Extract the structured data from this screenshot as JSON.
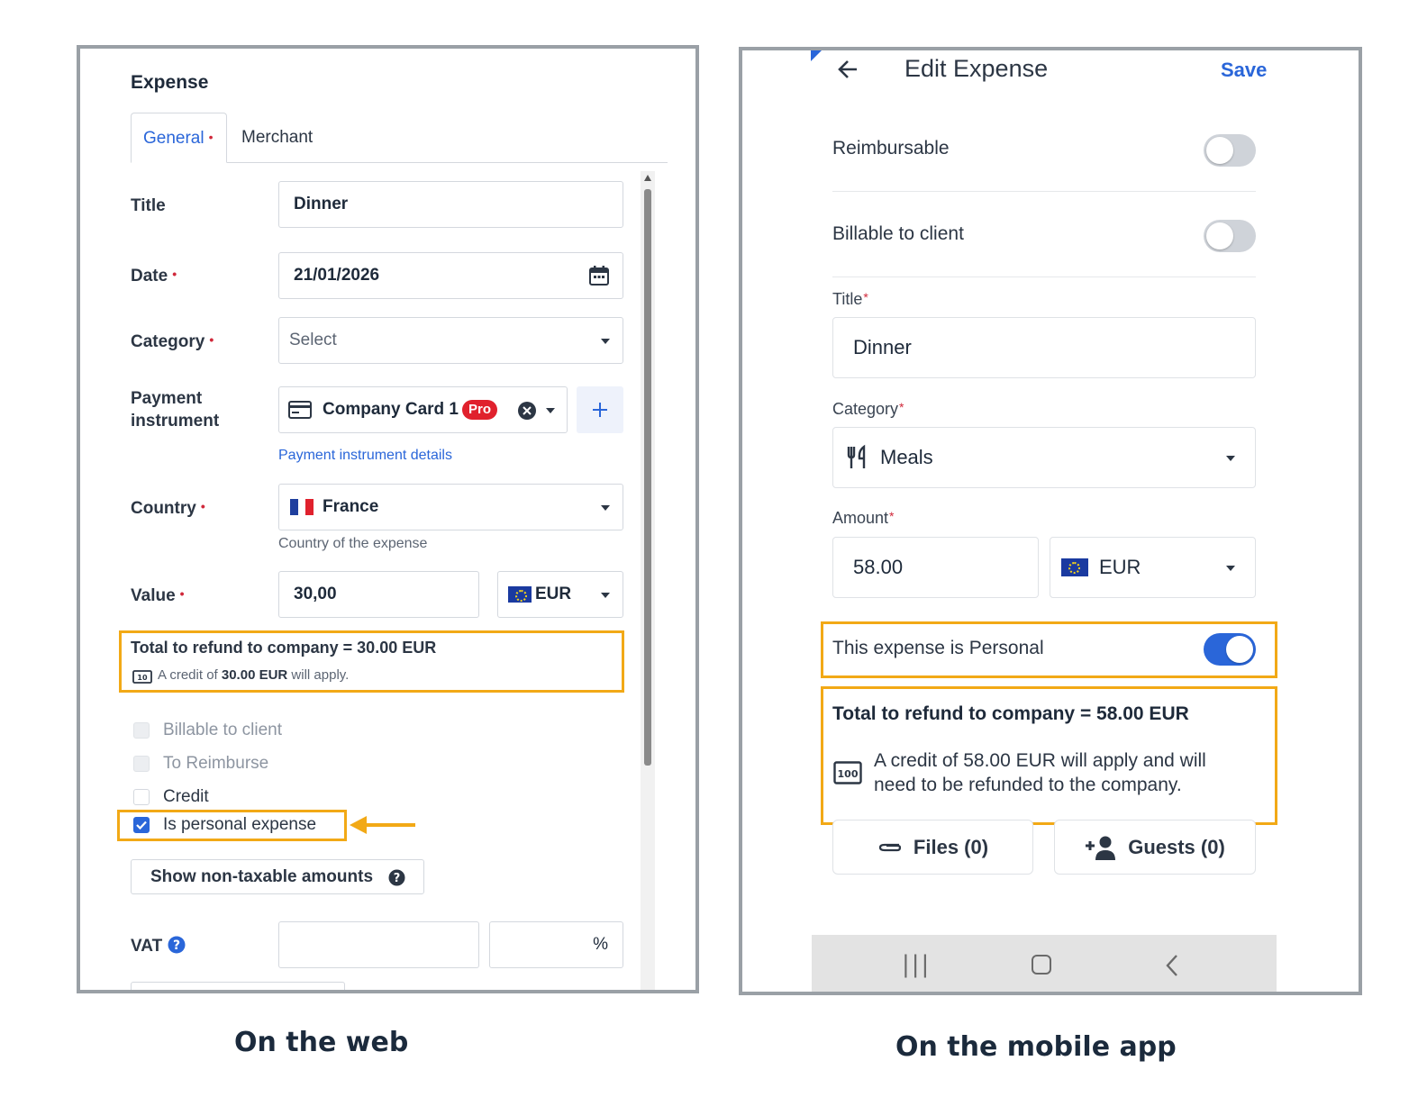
{
  "web": {
    "heading": "Expense",
    "tabs": [
      {
        "label": "General",
        "required": "•"
      },
      {
        "label": "Merchant"
      }
    ],
    "fields": {
      "title": {
        "label": "Title",
        "value": "Dinner"
      },
      "date": {
        "label": "Date",
        "required": "•",
        "value": "21/01/2026"
      },
      "category": {
        "label": "Category",
        "required": "•",
        "placeholder": "Select"
      },
      "payment": {
        "label_line1": "Payment",
        "label_line2": "instrument",
        "value": "Company Card 1",
        "badge": "Pro",
        "details_link": "Payment instrument details"
      },
      "country": {
        "label": "Country",
        "required": "•",
        "value": "France",
        "helper": "Country of the expense"
      },
      "value": {
        "label": "Value",
        "required": "•",
        "amount": "30,00",
        "currency": "EUR"
      },
      "vat": {
        "label": "VAT",
        "percent_symbol": "%"
      }
    },
    "refund": {
      "total_text": "Total to refund to company = 30.00 EUR",
      "credit_prefix": "A credit of ",
      "credit_amount": "30.00 EUR",
      "credit_suffix": " will apply."
    },
    "checkboxes": [
      {
        "label": "Billable to client",
        "state": "disabled"
      },
      {
        "label": "To Reimburse",
        "state": "disabled"
      },
      {
        "label": "Credit",
        "state": "unchecked"
      },
      {
        "label": "Is personal expense",
        "state": "checked"
      }
    ],
    "non_taxable_button": "Show non-taxable amounts",
    "flag_colors": {
      "blue": "#1f3f9e",
      "white": "#ffffff",
      "red": "#e0212d"
    },
    "highlight_color": "#f2a916"
  },
  "mobile": {
    "header": {
      "title": "Edit Expense",
      "save": "Save"
    },
    "toggles": {
      "reimbursable": {
        "label": "Reimbursable",
        "on": false
      },
      "billable": {
        "label": "Billable to client",
        "on": false
      },
      "personal": {
        "label": "This expense is Personal",
        "on": true
      }
    },
    "fields": {
      "title": {
        "label": "Title",
        "required": "*",
        "value": "Dinner"
      },
      "category": {
        "label": "Category",
        "required": "*",
        "value": "Meals"
      },
      "amount": {
        "label": "Amount",
        "required": "*",
        "value": "58.00",
        "currency": "EUR"
      }
    },
    "refund": {
      "total_prefix": "Total to refund to company = ",
      "total_amount": "58.00 EUR",
      "credit_line1": "A credit of 58.00 EUR will apply and will",
      "credit_line2": "need to be refunded to the company."
    },
    "buttons": {
      "files": "Files (0)",
      "guests": "Guests (0)"
    },
    "nav": {
      "recents": "|||",
      "home": "○",
      "back": "‹"
    }
  },
  "captions": {
    "web": "On the web",
    "mobile": "On the mobile app"
  }
}
